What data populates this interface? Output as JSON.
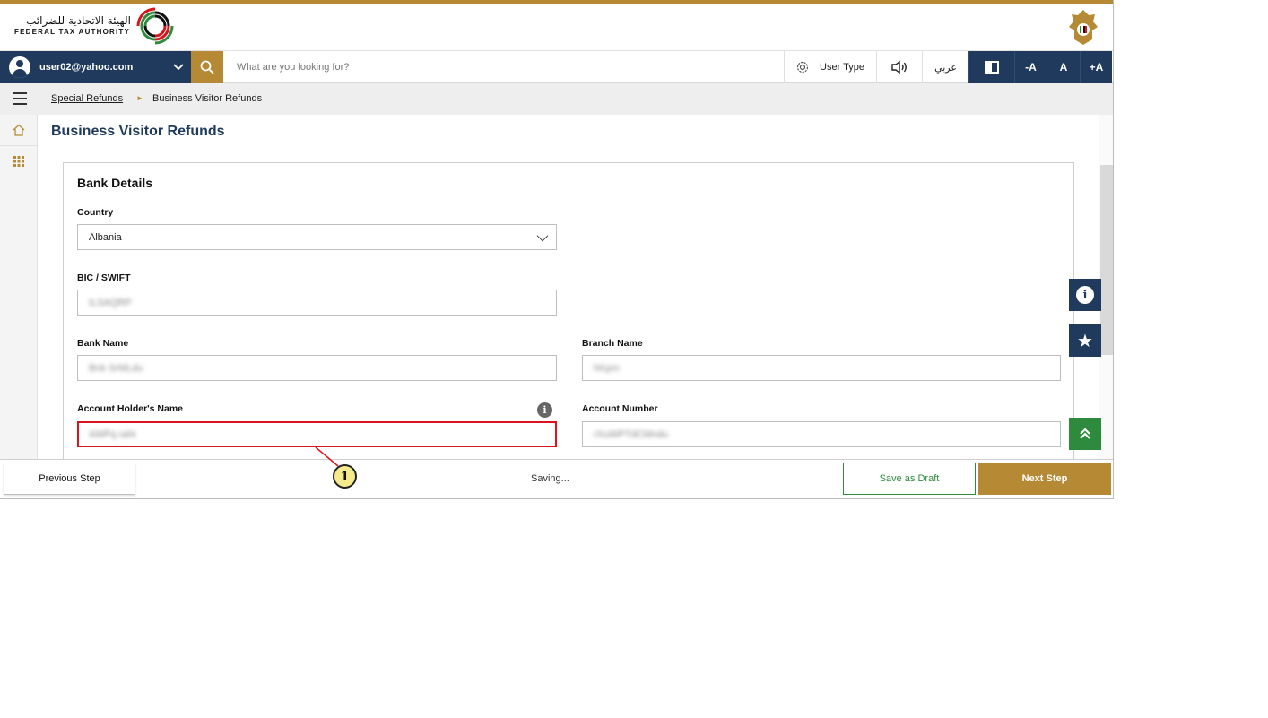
{
  "header": {
    "logo_arabic": "الهيئة الاتحادية للضرائب",
    "logo_english": "FEDERAL TAX AUTHORITY"
  },
  "toolbar": {
    "user_email": "user02@yahoo.com",
    "search_placeholder": "What are you looking for?",
    "user_type_label": "User Type",
    "arabic_label": "عربي",
    "font_minus": "-A",
    "font_normal": "A",
    "font_plus": "+A"
  },
  "breadcrumb": {
    "parent": "Special Refunds",
    "separator": "►",
    "current": "Business Visitor Refunds"
  },
  "page": {
    "title": "Business Visitor Refunds"
  },
  "bank_details": {
    "section_title": "Bank Details",
    "country_label": "Country",
    "country_value": "Albania",
    "bic_label": "BIC / SWIFT",
    "bic_value": "ILSAQRP",
    "bank_name_label": "Bank Name",
    "bank_name_value": "Bnk SrMLdu",
    "branch_name_label": "Branch Name",
    "branch_name_value": "hKpm",
    "account_holder_label": "Account Holder's Name",
    "account_holder_value": "kWPq raht",
    "account_number_label": "Account Number",
    "account_number_value": "rXuWPTdCMndu"
  },
  "footer": {
    "previous_label": "Previous Step",
    "status_text": "Saving...",
    "draft_label": "Save as Draft",
    "next_label": "Next Step"
  },
  "annotation": {
    "callout_number": "1"
  },
  "colors": {
    "navy": "#1f3a5c",
    "gold": "#b68a35",
    "green": "#2e8b3e",
    "error_red": "#d9141c"
  }
}
